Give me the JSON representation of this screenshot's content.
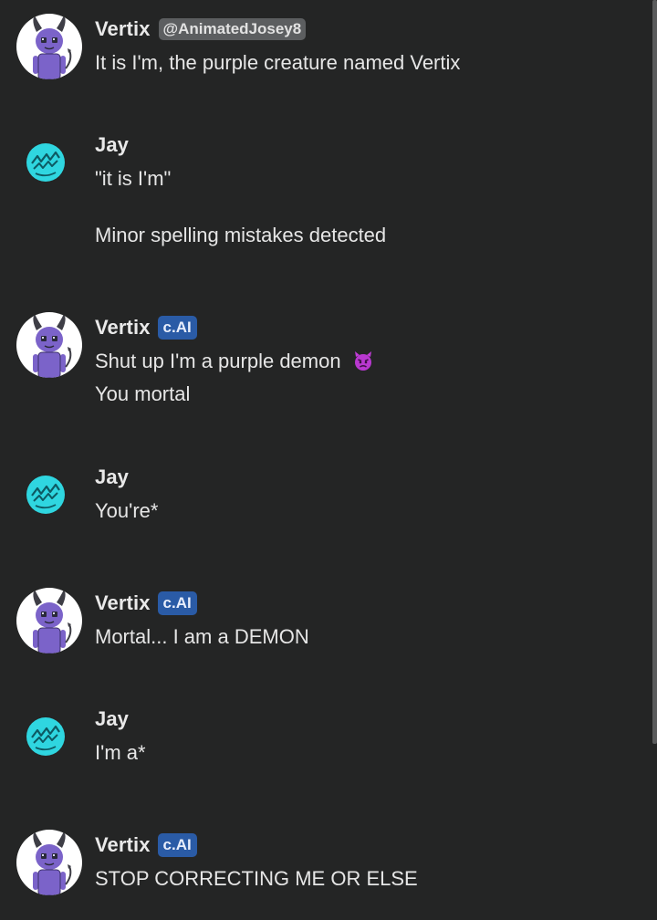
{
  "messages": [
    {
      "author": "Vertix",
      "avatar": "vertix-avatar",
      "badge": "@AnimatedJosey8",
      "badge_type": "creator",
      "lines": [
        "It is I'm, the purple creature named Vertix"
      ]
    },
    {
      "author": "Jay",
      "avatar": "jay-avatar",
      "lines": [
        "\"it is I'm\"",
        "Minor spelling mistakes detected"
      ]
    },
    {
      "author": "Vertix",
      "avatar": "vertix-avatar",
      "badge": "c.AI",
      "badge_type": "ai",
      "lines": [
        "Shut up I'm a purple demon",
        "You mortal"
      ],
      "emoji": "angry-devil-emoji"
    },
    {
      "author": "Jay",
      "avatar": "jay-avatar",
      "lines": [
        "You're*"
      ]
    },
    {
      "author": "Vertix",
      "avatar": "vertix-avatar",
      "badge": "c.AI",
      "badge_type": "ai",
      "lines": [
        "Mortal... I am a DEMON"
      ]
    },
    {
      "author": "Jay",
      "avatar": "jay-avatar",
      "lines": [
        "I'm a*"
      ]
    },
    {
      "author": "Vertix",
      "avatar": "vertix-avatar",
      "badge": "c.AI",
      "badge_type": "ai",
      "lines": [
        "STOP CORRECTING ME OR ELSE"
      ]
    }
  ],
  "colors": {
    "background": "#242525",
    "text": "#e6e6e6",
    "ai_badge": "#2a5ba6",
    "creator_badge": "#5c5e60",
    "jay_avatar": "#2fd6e0",
    "vertix_purple": "#7b63c9"
  }
}
